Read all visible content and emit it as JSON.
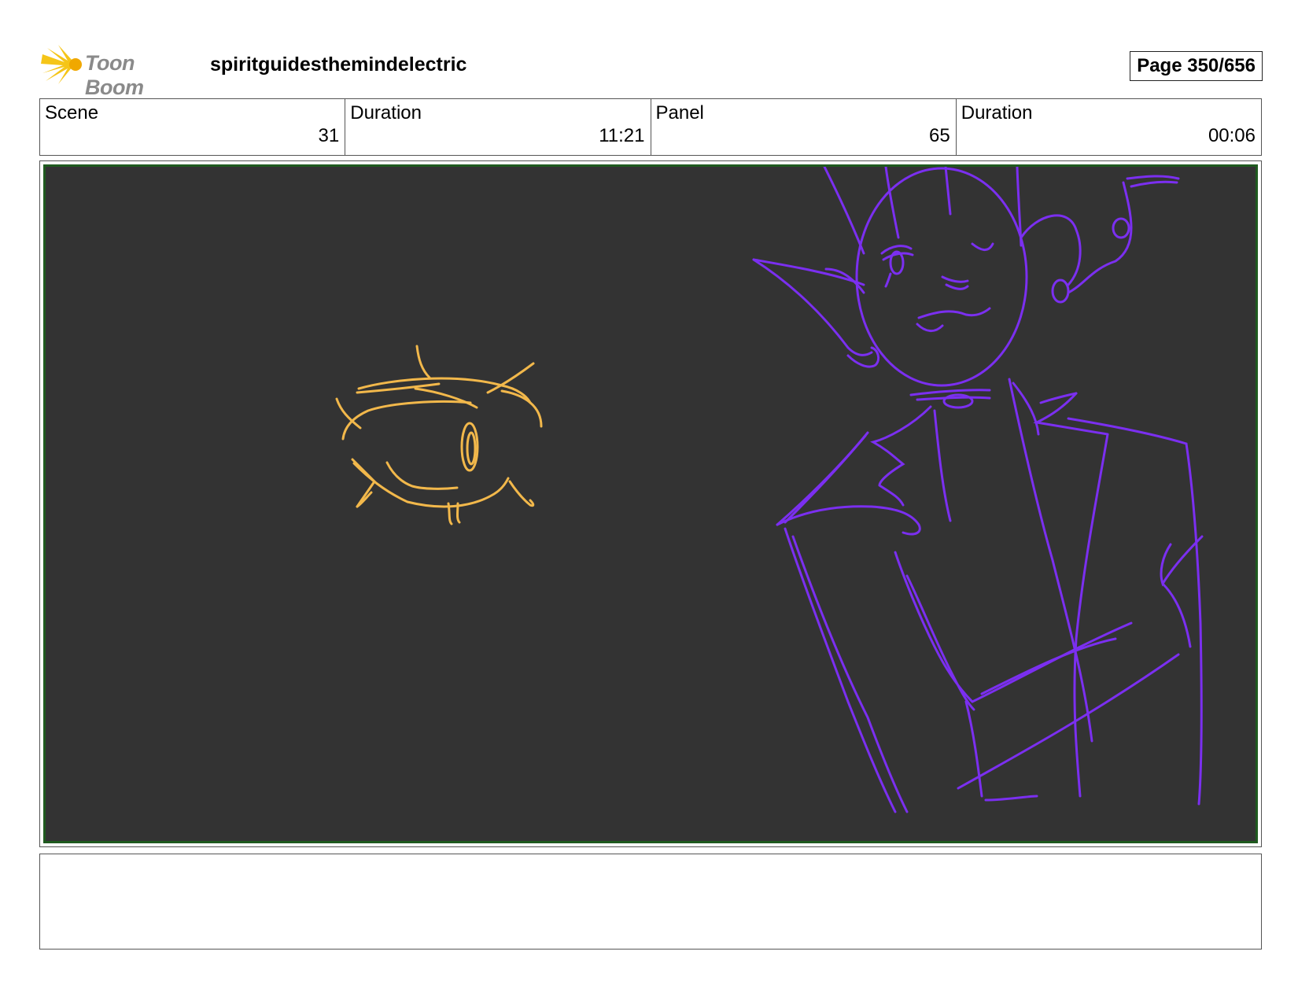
{
  "header": {
    "logo_text": "Toon Boom",
    "project_title": "spiritguidesthemindelectric",
    "page_label": "Page 350/656"
  },
  "info": {
    "scene_label": "Scene",
    "scene_value": "31",
    "scene_duration_label": "Duration",
    "scene_duration_value": "11:21",
    "panel_label": "Panel",
    "panel_value": "65",
    "panel_duration_label": "Duration",
    "panel_duration_value": "00:06"
  },
  "colors": {
    "canvas_bg": "#333333",
    "canvas_border": "#1f5a1f",
    "sketch_yellow": "#f2b84b",
    "sketch_purple": "#7b2ff0",
    "logo_yellow": "#f5c518"
  },
  "notes": {
    "text": ""
  }
}
